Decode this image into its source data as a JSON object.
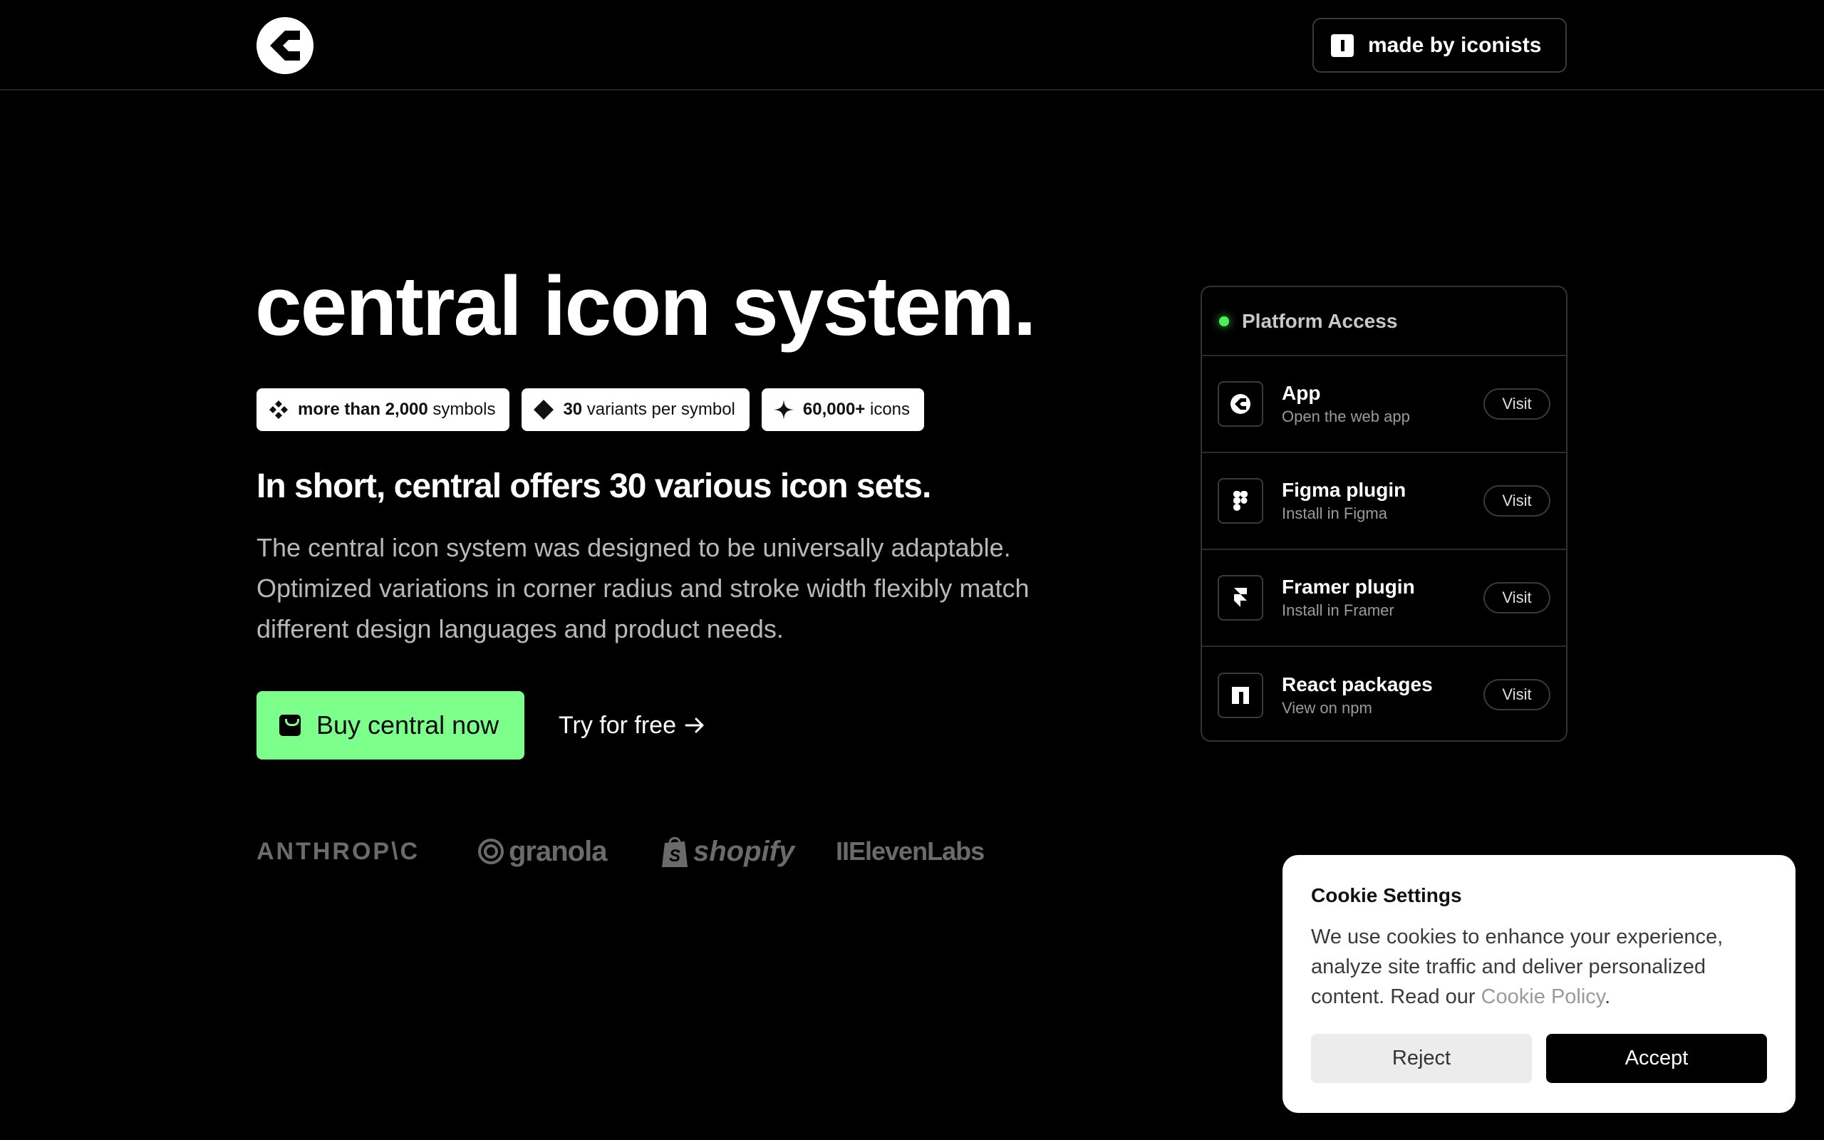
{
  "header": {
    "logo_icon": "central-logo-icon",
    "made_by_label": "made by iconists"
  },
  "hero": {
    "title": "central icon system.",
    "chips": [
      {
        "strong": "more than 2,000",
        "rest": " symbols",
        "icon": "diamond-cluster-icon"
      },
      {
        "strong": "30",
        "rest": " variants per symbol",
        "icon": "diamond-icon"
      },
      {
        "strong": "60,000+",
        "rest": " icons",
        "icon": "sparkle-icon"
      }
    ],
    "subhead": "In short, central offers 30 various icon sets.",
    "description": "The central icon system was designed to be universally adaptable. Optimized variations in corner radius and stroke width flexibly match different design languages and product needs.",
    "buy_label": "Buy central now",
    "try_label": "Try for free"
  },
  "brands": [
    "ANTHROP\\C",
    "granola",
    "shopify",
    "IIElevenLabs"
  ],
  "platform": {
    "title": "Platform Access",
    "status_color": "#4ef05a",
    "items": [
      {
        "title": "App",
        "subtitle": "Open the web app",
        "action": "Visit",
        "icon": "central-app-icon"
      },
      {
        "title": "Figma plugin",
        "subtitle": "Install in Figma",
        "action": "Visit",
        "icon": "figma-icon"
      },
      {
        "title": "Framer plugin",
        "subtitle": "Install in Framer",
        "action": "Visit",
        "icon": "framer-icon"
      },
      {
        "title": "React packages",
        "subtitle": "View on npm",
        "action": "Visit",
        "icon": "npm-icon"
      }
    ]
  },
  "cookie": {
    "title": "Cookie Settings",
    "body": "We use cookies to enhance your experience, analyze site traffic and deliver personalized content. Read our ",
    "link": "Cookie Policy",
    "body_end": ".",
    "reject": "Reject",
    "accept": "Accept"
  },
  "colors": {
    "accent_green": "#7dff8c",
    "background": "#000000"
  }
}
